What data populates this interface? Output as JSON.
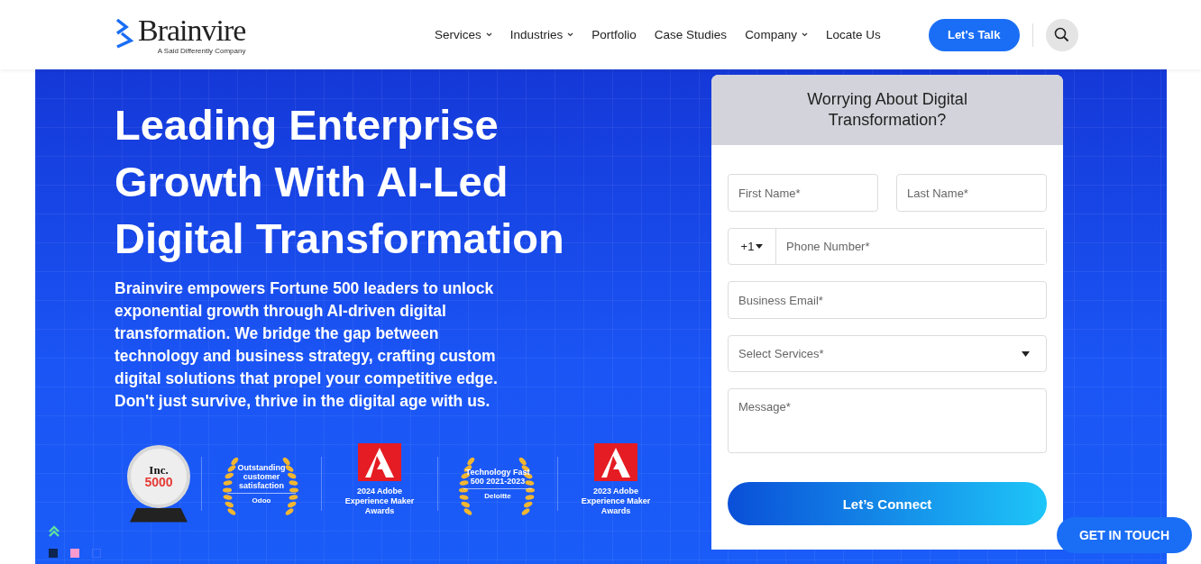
{
  "header": {
    "logo": {
      "name": "Brainvire",
      "tagline": "A Said Differently Company"
    },
    "nav": [
      {
        "label": "Services",
        "dropdown": true
      },
      {
        "label": "Industries",
        "dropdown": true
      },
      {
        "label": "Portfolio",
        "dropdown": false
      },
      {
        "label": "Case Studies",
        "dropdown": false
      },
      {
        "label": "Company",
        "dropdown": true
      },
      {
        "label": "Locate Us",
        "dropdown": false
      }
    ],
    "cta": "Let's Talk"
  },
  "hero": {
    "title": "Leading Enterprise Growth With AI-Led Digital Transformation",
    "description": "Brainvire empowers Fortune 500 leaders to unlock exponential growth through AI-driven digital transformation. We bridge the gap between technology and business strategy, crafting custom digital solutions that propel your competitive edge. Don't just survive, thrive in the digital age with us.",
    "awards": [
      {
        "kind": "trophy",
        "lines": [
          "Inc.",
          "5000"
        ]
      },
      {
        "kind": "laurel",
        "lines": [
          "Outstanding customer satisfaction"
        ],
        "source": "Odoo"
      },
      {
        "kind": "adobe",
        "lines": [
          "2024 Adobe Experience Maker Awards"
        ]
      },
      {
        "kind": "laurel",
        "lines": [
          "Technology Fast 500 2021-2023"
        ],
        "source": "Deloitte"
      },
      {
        "kind": "adobe",
        "lines": [
          "2023 Adobe Experience Maker Awards"
        ]
      }
    ]
  },
  "form": {
    "title": "Worrying About Digital Transformation?",
    "first_name": {
      "placeholder": "First Name*"
    },
    "last_name": {
      "placeholder": "Last Name*"
    },
    "country_code": "+1",
    "phone": {
      "placeholder": "Phone Number*"
    },
    "email": {
      "placeholder": "Business Email*"
    },
    "services": {
      "placeholder": "Select Services*"
    },
    "message": {
      "placeholder": "Message*"
    },
    "submit": "Let’s Connect"
  },
  "floating_button": "GET IN TOUCH"
}
